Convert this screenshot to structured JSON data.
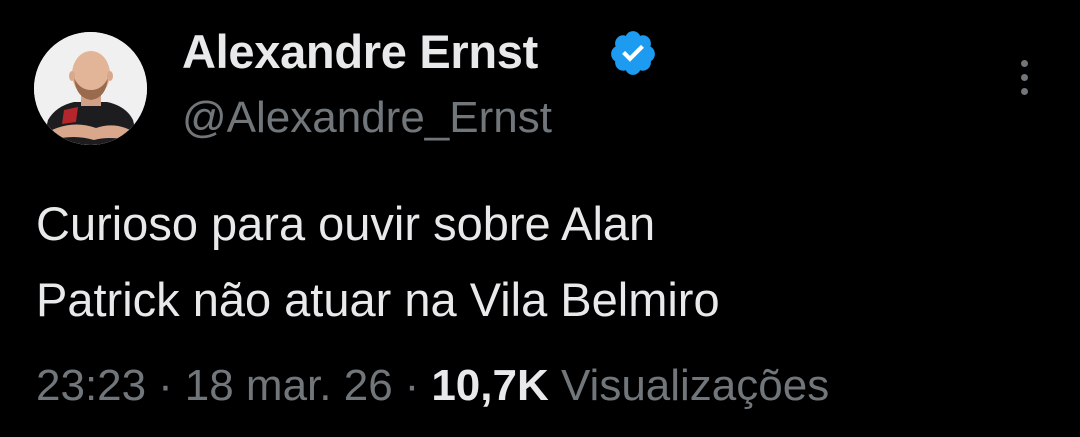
{
  "author": {
    "name": "Alexandre Ernst",
    "handle": "@Alexandre_Ernst",
    "verified_color": "#1d9bf0"
  },
  "tweet": {
    "text_lines": [
      "Curioso para ouvir sobre Alan",
      "Patrick não atuar na Vila Belmiro"
    ],
    "time": "23:23",
    "date": "18 mar. 26",
    "views_count": "10,7K",
    "views_label": "Visualizações"
  },
  "icons": {
    "more": "more-vertical-icon",
    "verified": "verified-badge-icon"
  },
  "colors": {
    "background": "#000000",
    "primary_text": "#e7e9ea",
    "secondary_text": "#71767b"
  }
}
